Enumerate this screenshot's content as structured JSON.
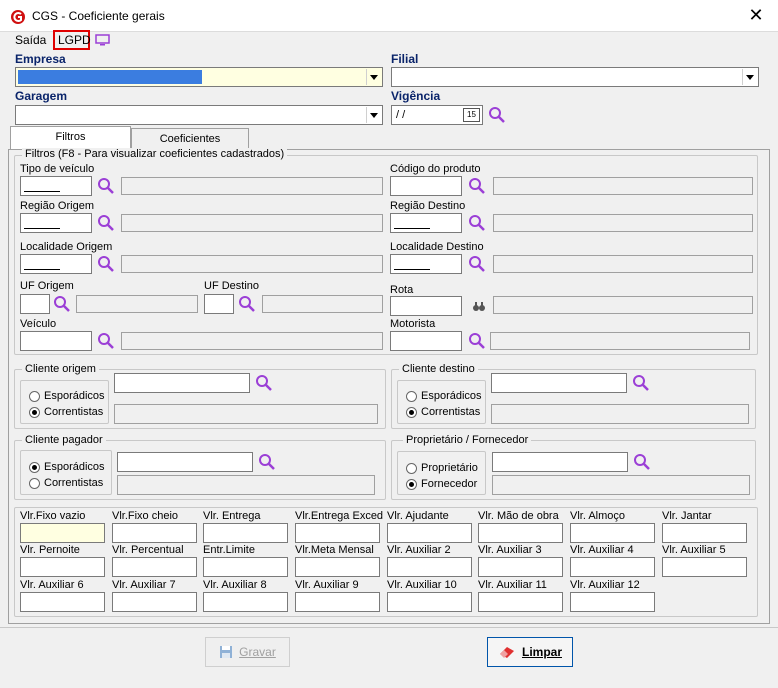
{
  "window": {
    "title": "CGS - Coeficiente gerais",
    "close": "✕"
  },
  "menu": {
    "saida": "Saída",
    "lgpd": "LGPD"
  },
  "header": {
    "empresa_label": "Empresa",
    "empresa_value": "",
    "filial_label": "Filial",
    "garagem_label": "Garagem",
    "vigencia_label": "Vigência",
    "vigencia_value": " / /",
    "calendar_label": "15"
  },
  "tabs": [
    {
      "label": "Filtros"
    },
    {
      "label": "Coeficientes"
    }
  ],
  "filtros": {
    "group_title": "Filtros (F8 - Para visualizar coeficientes cadastrados)",
    "tipo_veiculo": "Tipo de veículo",
    "codigo_produto": "Código do produto",
    "regiao_origem": "Região Origem",
    "regiao_destino": "Região Destino",
    "localidade_origem": "Localidade Origem",
    "localidade_destino": "Localidade Destino",
    "uf_origem": "UF Origem",
    "uf_destino": "UF Destino",
    "rota": "Rota",
    "veiculo": "Veículo",
    "motorista": "Motorista"
  },
  "cliente_origem": {
    "title": "Cliente origem",
    "opt1": "Esporádicos",
    "opt2": "Correntistas",
    "selected": "Correntistas"
  },
  "cliente_destino": {
    "title": "Cliente destino",
    "opt1": "Esporádicos",
    "opt2": "Correntistas",
    "selected": "Correntistas"
  },
  "cliente_pagador": {
    "title": "Cliente pagador",
    "opt1": "Esporádicos",
    "opt2": "Correntistas",
    "selected": "Esporádicos"
  },
  "proprietario": {
    "title": "Proprietário / Fornecedor",
    "opt1": "Proprietário",
    "opt2": "Fornecedor",
    "selected": "Fornecedor"
  },
  "coeficientes": {
    "row1": [
      "Vlr.Fixo vazio",
      "Vlr.Fixo cheio",
      "Vlr. Entrega",
      "Vlr.Entrega Exced",
      "Vlr. Ajudante",
      "Vlr. Mão de obra",
      "Vlr. Almoço",
      "Vlr. Jantar"
    ],
    "row2": [
      "Vlr. Pernoite",
      "Vlr. Percentual",
      "Entr.Limite",
      "Vlr.Meta Mensal",
      "Vlr. Auxiliar 2",
      "Vlr. Auxiliar 3",
      "Vlr. Auxiliar 4",
      "Vlr. Auxiliar 5"
    ],
    "row3": [
      "Vlr. Auxiliar 6",
      "Vlr. Auxiliar 7",
      "Vlr. Auxiliar 8",
      "Vlr. Auxiliar 9",
      "Vlr. Auxiliar 10",
      "Vlr. Auxiliar 11",
      "Vlr. Auxiliar 12"
    ]
  },
  "buttons": {
    "gravar": "Gravar",
    "limpar": "Limpar"
  },
  "colors": {
    "accent_purple": "#9b3fd6",
    "label_blue": "#0a246a",
    "highlight_yellow": "#ffffe1",
    "lgpd_border": "#e00000"
  }
}
